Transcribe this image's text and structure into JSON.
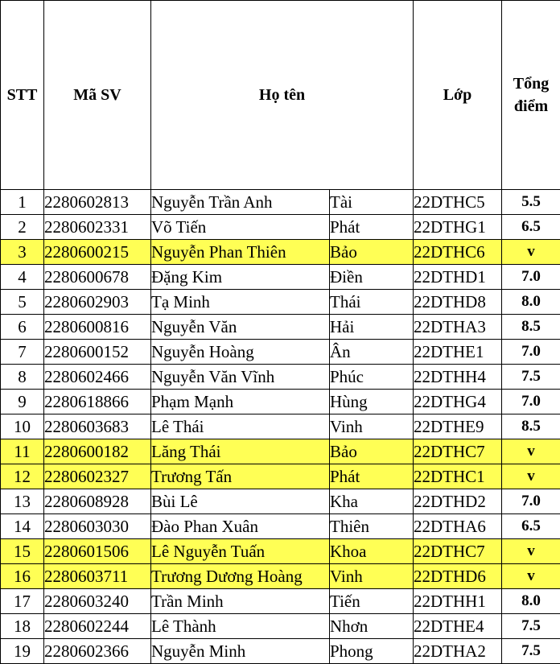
{
  "header": {
    "stt": "STT",
    "ma_sv": "Mã SV",
    "ho_ten": "Họ tên",
    "lop": "Lớp",
    "tong_diem_line1": "Tổng",
    "tong_diem_line2": "điểm"
  },
  "highlight_color": "#ffff55",
  "rows": [
    {
      "stt": "1",
      "ma_sv": "2280602813",
      "ho": "Nguyễn Trần Anh",
      "ten": "Tài",
      "lop": "22DTHC5",
      "diem": "5.5",
      "highlight": false
    },
    {
      "stt": "2",
      "ma_sv": "2280602331",
      "ho": "Võ Tiến",
      "ten": "Phát",
      "lop": "22DTHG1",
      "diem": "6.5",
      "highlight": false
    },
    {
      "stt": "3",
      "ma_sv": "2280600215",
      "ho": "Nguyễn Phan Thiên",
      "ten": "Bảo",
      "lop": "22DTHC6",
      "diem": "v",
      "highlight": true
    },
    {
      "stt": "4",
      "ma_sv": "2280600678",
      "ho": "Đặng Kim",
      "ten": "Điền",
      "lop": "22DTHD1",
      "diem": "7.0",
      "highlight": false
    },
    {
      "stt": "5",
      "ma_sv": "2280602903",
      "ho": "Tạ Minh",
      "ten": "Thái",
      "lop": "22DTHD8",
      "diem": "8.0",
      "highlight": false
    },
    {
      "stt": "6",
      "ma_sv": "2280600816",
      "ho": "Nguyễn Văn",
      "ten": "Hải",
      "lop": "22DTHA3",
      "diem": "8.5",
      "highlight": false
    },
    {
      "stt": "7",
      "ma_sv": "2280600152",
      "ho": "Nguyễn Hoàng",
      "ten": "Ân",
      "lop": "22DTHE1",
      "diem": "7.0",
      "highlight": false
    },
    {
      "stt": "8",
      "ma_sv": "2280602466",
      "ho": "Nguyễn Văn Vĩnh",
      "ten": "Phúc",
      "lop": "22DTHH4",
      "diem": "7.5",
      "highlight": false
    },
    {
      "stt": "9",
      "ma_sv": "2280618866",
      "ho": "Phạm Mạnh",
      "ten": "Hùng",
      "lop": "22DTHG4",
      "diem": "7.0",
      "highlight": false
    },
    {
      "stt": "10",
      "ma_sv": "2280603683",
      "ho": "Lê Thái",
      "ten": "Vinh",
      "lop": "22DTHE9",
      "diem": "8.5",
      "highlight": false
    },
    {
      "stt": "11",
      "ma_sv": "2280600182",
      "ho": "Lăng Thái",
      "ten": "Bảo",
      "lop": "22DTHC7",
      "diem": "v",
      "highlight": true
    },
    {
      "stt": "12",
      "ma_sv": "2280602327",
      "ho": "Trương Tấn",
      "ten": "Phát",
      "lop": "22DTHC1",
      "diem": "v",
      "highlight": true
    },
    {
      "stt": "13",
      "ma_sv": "2280608928",
      "ho": "Bùi Lê",
      "ten": "Kha",
      "lop": "22DTHD2",
      "diem": "7.0",
      "highlight": false
    },
    {
      "stt": "14",
      "ma_sv": "2280603030",
      "ho": "Đào Phan Xuân",
      "ten": "Thiên",
      "lop": "22DTHA6",
      "diem": "6.5",
      "highlight": false
    },
    {
      "stt": "15",
      "ma_sv": "2280601506",
      "ho": "Lê Nguyễn Tuấn",
      "ten": "Khoa",
      "lop": "22DTHC7",
      "diem": "v",
      "highlight": true
    },
    {
      "stt": "16",
      "ma_sv": "2280603711",
      "ho": "Trương Dương Hoàng",
      "ten": "Vinh",
      "lop": "22DTHD6",
      "diem": "v",
      "highlight": true
    },
    {
      "stt": "17",
      "ma_sv": "2280603240",
      "ho": "Trần Minh",
      "ten": "Tiến",
      "lop": "22DTHH1",
      "diem": "8.0",
      "highlight": false
    },
    {
      "stt": "18",
      "ma_sv": "2280602244",
      "ho": "Lê Thành",
      "ten": "Nhơn",
      "lop": "22DTHE4",
      "diem": "7.5",
      "highlight": false
    },
    {
      "stt": "19",
      "ma_sv": "2280602366",
      "ho": "Nguyễn Minh",
      "ten": "Phong",
      "lop": "22DTHA2",
      "diem": "7.5",
      "highlight": false
    }
  ]
}
